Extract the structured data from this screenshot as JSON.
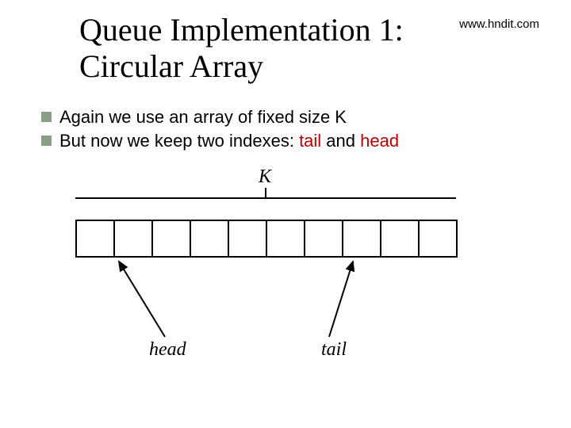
{
  "title_line1": "Queue Implementation 1:",
  "title_line2": "Circular Array",
  "site": "www.hndit.com",
  "bullets": {
    "b1": "Again we use an array of fixed size K",
    "b2_prefix": "But now we keep two indexes: ",
    "b2_tail": "tail",
    "b2_mid": "  and  ",
    "b2_head": "head"
  },
  "labels": {
    "K": "K",
    "head": "head",
    "tail": "tail"
  },
  "array": {
    "cells": 10
  }
}
